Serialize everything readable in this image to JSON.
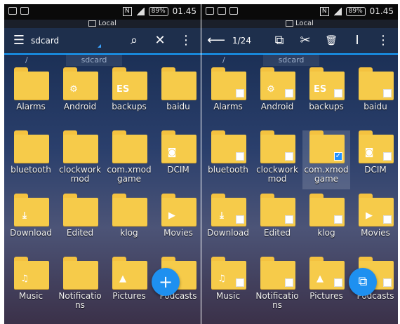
{
  "status_bar": {
    "time": "01.45",
    "battery": "89%",
    "nfc": "N"
  },
  "location_bar": {
    "label": "Local"
  },
  "left_screen": {
    "toolbar": {
      "menu_icon": "☰",
      "path": "sdcard",
      "search_icon": "⌕",
      "close_icon": "✕",
      "more_icon": "⋮"
    },
    "breadcrumb": {
      "root": "/",
      "current": "sdcard"
    },
    "folders": [
      {
        "label": "Alarms",
        "emblem": ""
      },
      {
        "label": "Android",
        "emblem": "⚙"
      },
      {
        "label": "backups",
        "emblem": "ES"
      },
      {
        "label": "baidu",
        "emblem": ""
      },
      {
        "label": "bluetooth",
        "emblem": ""
      },
      {
        "label": "clockwork mod",
        "emblem": ""
      },
      {
        "label": "com.xmod game",
        "emblem": ""
      },
      {
        "label": "DCIM",
        "emblem": "◙"
      },
      {
        "label": "Download",
        "emblem": "⤓"
      },
      {
        "label": "Edited",
        "emblem": ""
      },
      {
        "label": "klog",
        "emblem": ""
      },
      {
        "label": "Movies",
        "emblem": "▶"
      },
      {
        "label": "Music",
        "emblem": "♫"
      },
      {
        "label": "Notificatio ns",
        "emblem": ""
      },
      {
        "label": "Pictures",
        "emblem": "▲"
      },
      {
        "label": "Podcasts",
        "emblem": ""
      }
    ],
    "fab_icon": "+"
  },
  "right_screen": {
    "toolbar": {
      "back_icon": "⟵",
      "counter": "1/24",
      "copy_icon": "⧉",
      "cut_icon": "✂",
      "delete_icon": "🗑",
      "rename_icon": "I",
      "more_icon": "⋮"
    },
    "breadcrumb": {
      "root": "/",
      "current": "sdcard"
    },
    "selected_index": 6,
    "fab_icon": "⧉"
  },
  "colors": {
    "accent": "#1e90f0",
    "folder": "#f6cb4a",
    "toolbar": "#1e2f4c"
  }
}
